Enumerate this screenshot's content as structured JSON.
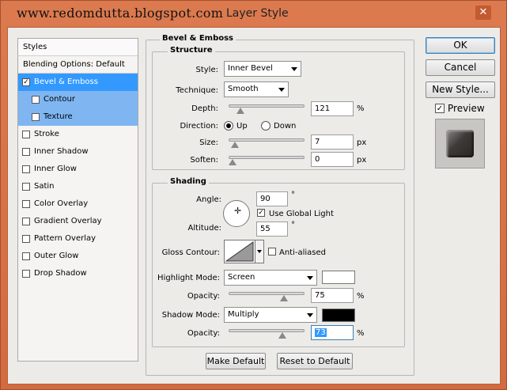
{
  "window": {
    "watermark": "www.redomdutta.blogspot.com",
    "title": "Layer Style",
    "close_glyph": "✕"
  },
  "styles_list": {
    "header": "Styles",
    "blending_options": "Blending Options: Default",
    "items": [
      {
        "label": "Bevel & Emboss",
        "checked": true
      },
      {
        "label": "Contour",
        "checked": false
      },
      {
        "label": "Texture",
        "checked": false
      },
      {
        "label": "Stroke",
        "checked": false
      },
      {
        "label": "Inner Shadow",
        "checked": false
      },
      {
        "label": "Inner Glow",
        "checked": false
      },
      {
        "label": "Satin",
        "checked": false
      },
      {
        "label": "Color Overlay",
        "checked": false
      },
      {
        "label": "Gradient Overlay",
        "checked": false
      },
      {
        "label": "Pattern Overlay",
        "checked": false
      },
      {
        "label": "Outer Glow",
        "checked": false
      },
      {
        "label": "Drop Shadow",
        "checked": false
      }
    ]
  },
  "bevel": {
    "section_title": "Bevel & Emboss",
    "structure_title": "Structure",
    "style_label": "Style:",
    "style_value": "Inner Bevel",
    "technique_label": "Technique:",
    "technique_value": "Smooth",
    "depth_label": "Depth:",
    "depth_value": "121",
    "depth_unit": "%",
    "depth_level": 0.12,
    "direction_label": "Direction:",
    "direction_up": "Up",
    "direction_down": "Down",
    "size_label": "Size:",
    "size_value": "7",
    "size_unit": "px",
    "size_level": 0.03,
    "soften_label": "Soften:",
    "soften_value": "0",
    "soften_unit": "px",
    "soften_level": 0.0
  },
  "shading": {
    "title": "Shading",
    "angle_label": "Angle:",
    "angle_value": "90",
    "degree_symbol": "°",
    "use_global_light": "Use Global Light",
    "altitude_label": "Altitude:",
    "altitude_value": "55",
    "gloss_contour_label": "Gloss Contour:",
    "anti_aliased": "Anti-aliased",
    "highlight_mode_label": "Highlight Mode:",
    "highlight_mode_value": "Screen",
    "highlight_color": "#ffffff",
    "highlight_opacity_label": "Opacity:",
    "highlight_opacity_value": "75",
    "highlight_opacity_level": 0.75,
    "shadow_mode_label": "Shadow Mode:",
    "shadow_mode_value": "Multiply",
    "shadow_color": "#000000",
    "shadow_opacity_label": "Opacity:",
    "shadow_opacity_value": "73",
    "shadow_opacity_level": 0.73,
    "percent": "%"
  },
  "footer": {
    "make_default": "Make Default",
    "reset_to_default": "Reset to Default"
  },
  "right_panel": {
    "ok": "OK",
    "cancel": "Cancel",
    "new_style": "New Style...",
    "preview_label": "Preview"
  },
  "colors": {
    "titlebar": "#d36b40",
    "selection": "#3399ff",
    "dialog_bg": "#edebe8"
  }
}
